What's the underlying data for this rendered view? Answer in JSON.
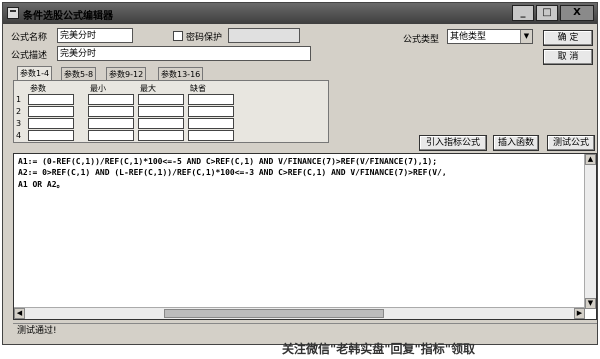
{
  "window": {
    "title": "条件选股公式编辑器",
    "min_label": "_",
    "max_label": "□",
    "close_label": "X"
  },
  "form": {
    "formula_name_label": "公式名称",
    "formula_name_value": "完美分时",
    "password_label": "密码保护",
    "formula_desc_label": "公式描述",
    "formula_desc_value": "完美分时",
    "formula_type_label": "公式类型",
    "formula_type_value": "其他类型"
  },
  "buttons": {
    "ok": "确  定",
    "cancel": "取  消",
    "import_indicator": "引入指标公式",
    "insert_function": "插入函数",
    "test_formula": "测试公式"
  },
  "tabs": [
    "参数1-4",
    "参数5-8",
    "参数9-12",
    "参数13-16"
  ],
  "params": {
    "columns": [
      "参数",
      "最小",
      "最大",
      "缺省"
    ],
    "rows": [
      "1",
      "2",
      "3",
      "4"
    ]
  },
  "editor": {
    "lines": [
      "A1:= (0-REF(C,1))/REF(C,1)*100<=-5 AND C>REF(C,1) AND V/FINANCE(7)>REF(V/FINANCE(7),1);",
      "A2:= 0>REF(C,1) AND (L-REF(C,1))/REF(C,1)*100<=-3 AND C>REF(C,1) AND  V/FINANCE(7)>REF(V/,",
      "A1 OR A2。"
    ]
  },
  "status": {
    "text": "测试通过!"
  },
  "watermark": {
    "text": "关注微信\"老韩实盘\"回复\"指标\"领取"
  },
  "colors": {
    "titlebar": "#4e4e4e",
    "dialog_bg": "#d4d0c8",
    "editor_bg": "#ffffff"
  },
  "icons": {
    "dropdown": "chevron-down-icon",
    "scroll_left": "arrow-left-icon",
    "scroll_right": "arrow-right-icon",
    "scroll_up": "arrow-up-icon",
    "scroll_down": "arrow-down-icon"
  }
}
